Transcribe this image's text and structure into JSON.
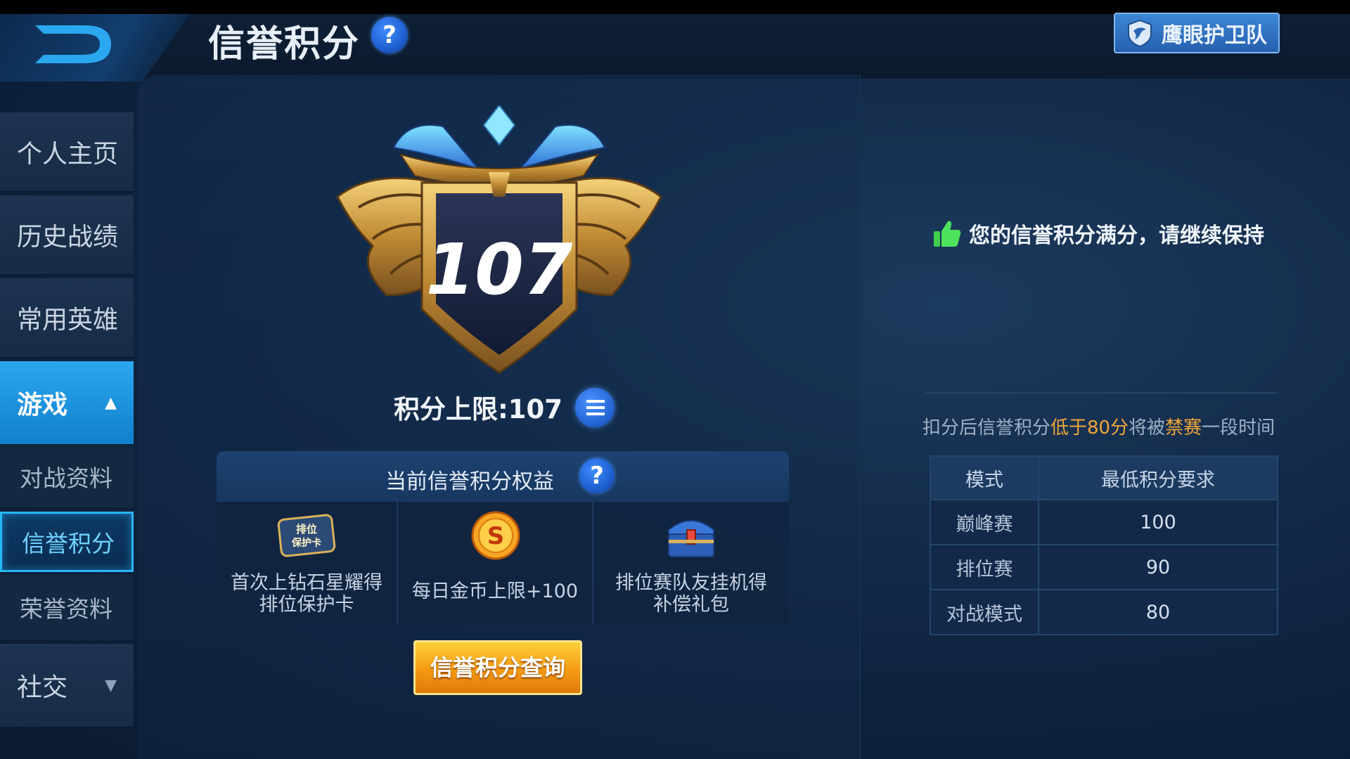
{
  "header": {
    "title": "信誉积分",
    "guard_button": "鹰眼护卫队"
  },
  "sidebar": {
    "items": [
      {
        "label": "个人主页"
      },
      {
        "label": "历史战绩"
      },
      {
        "label": "常用英雄"
      },
      {
        "label": "游戏"
      },
      {
        "label": "对战资料"
      },
      {
        "label": "信誉积分"
      },
      {
        "label": "荣誉资料"
      },
      {
        "label": "社交"
      }
    ]
  },
  "score": {
    "value": "107",
    "limit_label": "积分上限:107"
  },
  "benefits": {
    "title": "当前信誉积分权益",
    "items": [
      {
        "icon": "rank-protection-card-icon",
        "icon_text": "排位\n保护卡",
        "label_line1": "首次上钻石星耀得",
        "label_line2": "排位保护卡"
      },
      {
        "icon": "gold-coin-icon",
        "label_line1": "每日金币上限+100",
        "label_line2": ""
      },
      {
        "icon": "treasure-chest-icon",
        "label_line1": "排位赛队友挂机得",
        "label_line2": "补偿礼包"
      }
    ]
  },
  "query_button": "信誉积分查询",
  "status_message": "您的信誉积分满分，请继续保持",
  "notice": {
    "part1": "扣分后信誉积分",
    "part2": "低于80分",
    "part3": "将被",
    "part4": "禁赛",
    "part5": "一段时间"
  },
  "requirements_table": {
    "headers": [
      "模式",
      "最低积分要求"
    ],
    "rows": [
      [
        "巅峰赛",
        "100"
      ],
      [
        "排位赛",
        "90"
      ],
      [
        "对战模式",
        "80"
      ]
    ]
  },
  "colors": {
    "accent_blue": "#29b6f6",
    "highlight_orange": "#f0a63a",
    "button_gold": "#f39a13"
  }
}
